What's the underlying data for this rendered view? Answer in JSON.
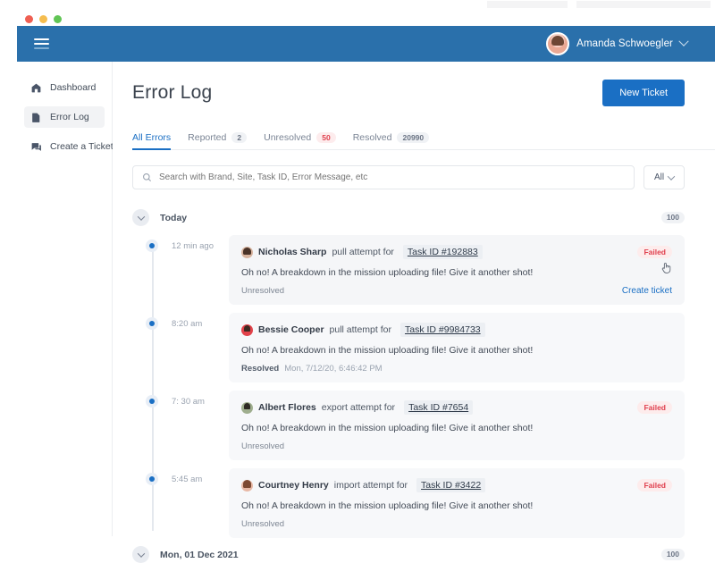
{
  "window": {
    "traffic_lights": [
      "red",
      "yellow",
      "green"
    ]
  },
  "appbar": {
    "menu_icon": "hamburger-icon",
    "user": {
      "name": "Amanda Schwoegler",
      "avatar": "user-avatar",
      "chevron": "chevron-down-icon"
    },
    "color": "#2a70ab"
  },
  "sidebar": {
    "items": [
      {
        "label": "Dashboard",
        "icon": "home-icon",
        "active": false
      },
      {
        "label": "Error Log",
        "icon": "error-log-icon",
        "active": true
      },
      {
        "label": "Create a Ticket",
        "icon": "chat-bubbles-icon",
        "active": false
      }
    ]
  },
  "page": {
    "title": "Error Log",
    "new_ticket_label": "New Ticket",
    "accent_color": "#1a6fc4"
  },
  "tabs": [
    {
      "label": "All Errors",
      "count": "",
      "active": true,
      "pill_style": "none"
    },
    {
      "label": "Reported",
      "count": "2",
      "active": false,
      "pill_style": "neutral"
    },
    {
      "label": "Unresolved",
      "count": "50",
      "active": false,
      "pill_style": "danger"
    },
    {
      "label": "Resolved",
      "count": "20990",
      "active": false,
      "pill_style": "neutral"
    }
  ],
  "search": {
    "placeholder": "Search with Brand, Site, Task ID, Error Message, etc",
    "value": "",
    "icon": "search-icon",
    "filter_label": "All"
  },
  "groups": [
    {
      "title": "Today",
      "count": "100",
      "toggle_icon": "chevron-down-icon",
      "entries": [
        {
          "time": "12 min ago",
          "person": "Nicholas Sharp",
          "avatar": "av1",
          "action": "pull attempt for",
          "task_id": "Task ID #192883",
          "badge": "Failed",
          "message": "Oh no! A breakdown in the mission uploading file! Give it another shot!",
          "foot_status": "Unresolved",
          "foot_time": "",
          "create_ticket": "Create ticket",
          "hovered": true
        },
        {
          "time": "8:20 am",
          "person": "Bessie Cooper",
          "avatar": "av2",
          "action": "pull attempt for",
          "task_id": "Task ID #9984733",
          "badge": "",
          "message": "Oh no! A breakdown in the mission uploading file! Give it another shot!",
          "foot_status": "Resolved",
          "foot_time": "Mon, 7/12/20, 6:46:42 PM",
          "create_ticket": "",
          "hovered": false
        },
        {
          "time": "7: 30 am",
          "person": "Albert Flores",
          "avatar": "av3",
          "action": "export attempt for",
          "task_id": "Task ID #7654",
          "badge": "Failed",
          "message": "Oh no! A breakdown in the mission uploading file! Give it another shot!",
          "foot_status": "Unresolved",
          "foot_time": "",
          "create_ticket": "",
          "hovered": false
        },
        {
          "time": "5:45 am",
          "person": "Courtney Henry",
          "avatar": "av4",
          "action": "import attempt for",
          "task_id": "Task ID #3422",
          "badge": "Failed",
          "message": "Oh no! A breakdown in the mission uploading file! Give it another shot!",
          "foot_status": "Unresolved",
          "foot_time": "",
          "create_ticket": "",
          "hovered": false
        }
      ]
    },
    {
      "title": "Mon, 01 Dec 2021",
      "count": "100",
      "toggle_icon": "chevron-down-icon",
      "entries": []
    }
  ]
}
